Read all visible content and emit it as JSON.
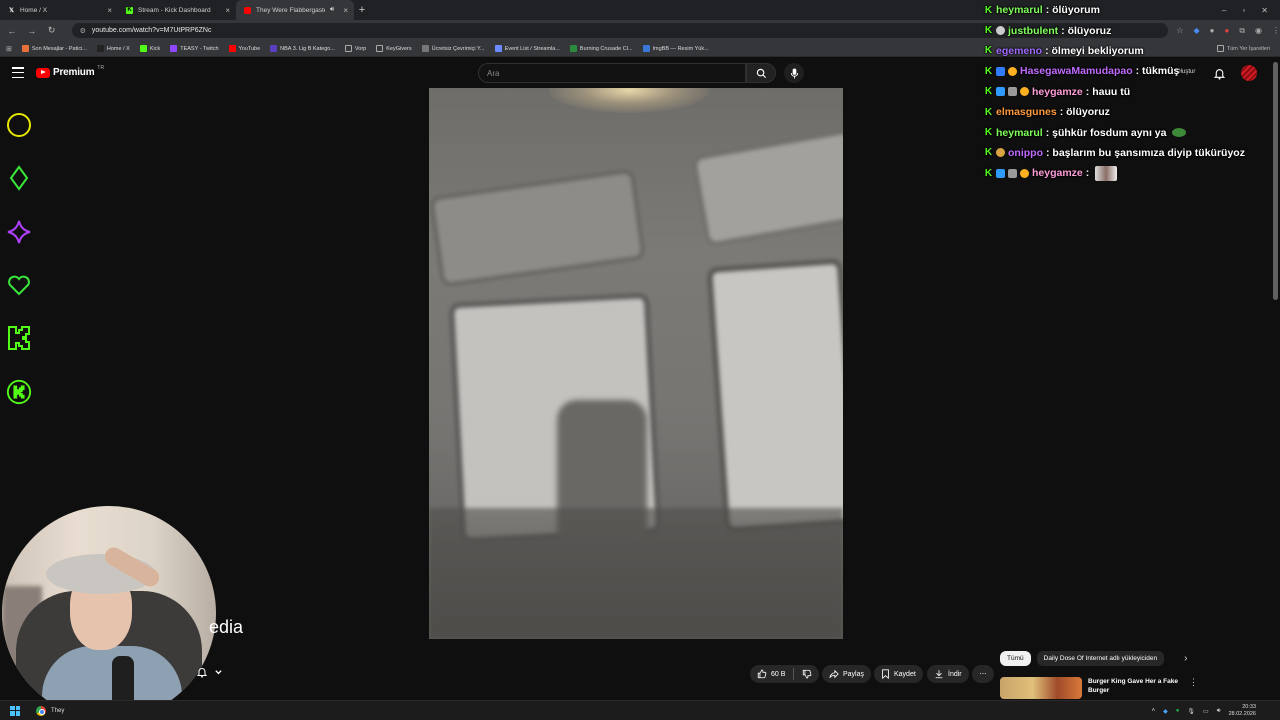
{
  "browser": {
    "tabs": [
      {
        "label": "Home / X",
        "icon": "x-icon",
        "active": false
      },
      {
        "label": "Stream - Kick Dashboard",
        "icon": "kick-icon",
        "active": false
      },
      {
        "label": "They Were Flabbergasted",
        "icon": "youtube-icon",
        "active": true
      }
    ],
    "url": "youtube.com/watch?v=M7UtPRP6ZNc",
    "bookmarks": [
      {
        "label": "Son Mesajlar - Patici...",
        "color": "#e8713a"
      },
      {
        "label": "Home / X",
        "color": "#222222"
      },
      {
        "label": "Kick",
        "color": "#53fc18"
      },
      {
        "label": "TEASY - Twitch",
        "color": "#9146ff"
      },
      {
        "label": "YouTube",
        "color": "#ff0000"
      },
      {
        "label": "NBA 3. Lig B Katego...",
        "color": "#5a3fbf"
      },
      {
        "label": "Vorp",
        "color": "#777777"
      },
      {
        "label": "KeyGivers",
        "color": "#777777"
      },
      {
        "label": "Ücretsiz Çevrimiçi Y...",
        "color": "#777777"
      },
      {
        "label": "Event List / Streamla...",
        "color": "#6b8cff"
      },
      {
        "label": "Burning Crusade Cl...",
        "color": "#2b8a3e"
      },
      {
        "label": "ImgBB — Resim Yük...",
        "color": "#3a78d8"
      }
    ],
    "bookmarks_right": "Tüm Yer İşaretleri"
  },
  "youtube": {
    "logo_word": "Premium",
    "logo_region": "TR",
    "search_placeholder": "Ara",
    "overlay_text": "edia",
    "actions": {
      "like_count": "60 B",
      "share": "Paylaş",
      "save": "Kaydet",
      "download": "İndir"
    },
    "chips": [
      "Tümü",
      "Daily Dose Of Internet adlı yükleyiciden"
    ],
    "recommendation": {
      "title": "Burger King Gave Her a Fake Burger"
    },
    "partial_create": "Oluştur"
  },
  "side_icons": [
    {
      "name": "circle-icon",
      "color": "#e6e600"
    },
    {
      "name": "diamond-icon",
      "color": "#39e639"
    },
    {
      "name": "star-icon",
      "color": "#b040ff"
    },
    {
      "name": "heart-icon",
      "color": "#39e639"
    },
    {
      "name": "kick-k-icon",
      "color": "#53fc18"
    },
    {
      "name": "kick-badge-icon",
      "color": "#53fc18"
    }
  ],
  "chat": [
    {
      "user": "heymarul",
      "color": "#7fff59",
      "text": ": ölüyorum",
      "badges": []
    },
    {
      "user": "justbulent",
      "color": "#7fff59",
      "text": ": ölüyoruz",
      "badges": [
        "#cccccc"
      ]
    },
    {
      "user": "egemeno",
      "color": "#9f6bff",
      "text": ": ölmeyi bekliyorum",
      "badges": []
    },
    {
      "user": "HasegawaMamudapao",
      "color": "#c06bff",
      "text": ": tükmüş",
      "badges": [
        "#2f7cff",
        "#ffb020"
      ]
    },
    {
      "user": "heygamze",
      "color": "#ff9ed8",
      "text": ": hauu tü",
      "badges": [
        "#2f9bff",
        "#9a9a9a",
        "#ffb020"
      ]
    },
    {
      "user": "elmasgunes",
      "color": "#ff9a3c",
      "text": ": ölüyoruz",
      "badges": []
    },
    {
      "user": "heymarul",
      "color": "#7fff59",
      "text": ": şühkür fosdum aynı ya",
      "badges": []
    },
    {
      "user": "onippo",
      "color": "#c06bff",
      "text": ": başlarım bu şansımıza diyip tükürüyoz",
      "badges": [
        "#d9a441"
      ]
    },
    {
      "user": "heygamze",
      "color": "#ff9ed8",
      "text": ":",
      "badges": [
        "#2f9bff",
        "#9a9a9a",
        "#ffb020"
      ]
    }
  ],
  "taskbar": {
    "app_label": "They",
    "time": "20:33",
    "date": "28.02.2026"
  }
}
